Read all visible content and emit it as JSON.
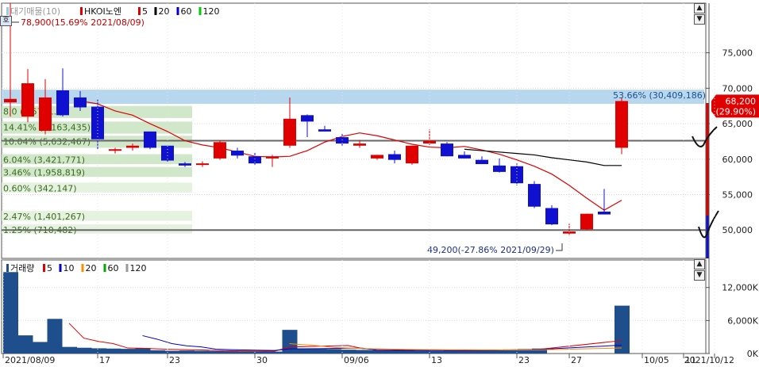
{
  "chart_data": [
    {
      "type": "candlestick",
      "legend": {
        "items": [
          {
            "label": "대기매물(10)",
            "color": "#9ecae1"
          },
          {
            "label": "HKOI노엔",
            "color": "#e00000"
          },
          {
            "label": "5",
            "color": "#e00000"
          },
          {
            "label": "20",
            "color": "#000000"
          },
          {
            "label": "60",
            "color": "#0000cc"
          },
          {
            "label": "120",
            "color": "#00cc00"
          }
        ]
      },
      "ylim": [
        46000,
        82000
      ],
      "yticks": [
        "75,000",
        "70,000",
        "65,000",
        "60,000",
        "55,000",
        "50,000"
      ],
      "ytick_values": [
        75000,
        70000,
        65000,
        60000,
        55000,
        50000
      ],
      "xticks": [
        "2021/08/09",
        "17",
        "23",
        "30",
        "09/06",
        "13",
        "23",
        "27",
        "10/05",
        "11",
        "2021/10/12"
      ],
      "xtick_index": [
        0,
        5,
        9,
        14,
        19,
        24,
        29,
        32,
        37,
        41,
        44
      ],
      "candles": [
        {
          "o": 68000,
          "h": 82000,
          "l": 66000,
          "c": 68500
        },
        {
          "o": 66000,
          "h": 72700,
          "l": 65200,
          "c": 70700
        },
        {
          "o": 64000,
          "h": 71300,
          "l": 63500,
          "c": 68700
        },
        {
          "o": 69700,
          "h": 72800,
          "l": 66000,
          "c": 66200
        },
        {
          "o": 68700,
          "h": 69600,
          "l": 66800,
          "c": 67300
        },
        {
          "o": 67400,
          "h": 68400,
          "l": 61400,
          "c": 62800
        },
        {
          "o": 61200,
          "h": 61600,
          "l": 60800,
          "c": 61400
        },
        {
          "o": 61600,
          "h": 62200,
          "l": 61200,
          "c": 61900
        },
        {
          "o": 63900,
          "h": 63900,
          "l": 61400,
          "c": 61600
        },
        {
          "o": 61900,
          "h": 61900,
          "l": 59600,
          "c": 59800
        },
        {
          "o": 59400,
          "h": 59600,
          "l": 58900,
          "c": 59100
        },
        {
          "o": 59200,
          "h": 59700,
          "l": 58900,
          "c": 59400
        },
        {
          "o": 60100,
          "h": 62600,
          "l": 59900,
          "c": 62400
        },
        {
          "o": 61200,
          "h": 61600,
          "l": 60100,
          "c": 60500
        },
        {
          "o": 60400,
          "h": 60900,
          "l": 59200,
          "c": 59400
        },
        {
          "o": 60100,
          "h": 60600,
          "l": 58900,
          "c": 60400
        },
        {
          "o": 61900,
          "h": 68700,
          "l": 61600,
          "c": 65700
        },
        {
          "o": 66200,
          "h": 66300,
          "l": 63100,
          "c": 65300
        },
        {
          "o": 64200,
          "h": 64700,
          "l": 63900,
          "c": 63900
        },
        {
          "o": 63100,
          "h": 63600,
          "l": 61900,
          "c": 62200
        },
        {
          "o": 61900,
          "h": 62700,
          "l": 61600,
          "c": 62200
        },
        {
          "o": 60100,
          "h": 60600,
          "l": 59900,
          "c": 60600
        },
        {
          "o": 60700,
          "h": 61200,
          "l": 59400,
          "c": 59900
        },
        {
          "o": 59400,
          "h": 61300,
          "l": 59200,
          "c": 61900
        },
        {
          "o": 62200,
          "h": 64200,
          "l": 62000,
          "c": 62600
        },
        {
          "o": 62200,
          "h": 62400,
          "l": 60400,
          "c": 60400
        },
        {
          "o": 60600,
          "h": 61100,
          "l": 60100,
          "c": 60100
        },
        {
          "o": 59900,
          "h": 60400,
          "l": 59300,
          "c": 59300
        },
        {
          "o": 59100,
          "h": 60100,
          "l": 58100,
          "c": 58200
        },
        {
          "o": 59000,
          "h": 59400,
          "l": 56300,
          "c": 56600
        },
        {
          "o": 56500,
          "h": 56900,
          "l": 53100,
          "c": 53300
        },
        {
          "o": 53100,
          "h": 53500,
          "l": 50700,
          "c": 50800
        },
        {
          "o": 49500,
          "h": 50900,
          "l": 49200,
          "c": 49800
        },
        {
          "o": 50100,
          "h": 52300,
          "l": 50000,
          "c": 52300
        },
        {
          "o": 52600,
          "h": 55800,
          "l": 52200,
          "c": 52200
        },
        {
          "o": 61600,
          "h": 68700,
          "l": 60700,
          "c": 68200
        }
      ],
      "ma": [
        {
          "name": "5",
          "color": "#e00000",
          "values": [
            null,
            null,
            null,
            null,
            68200,
            67800,
            66800,
            66200,
            65000,
            63900,
            62600,
            62000,
            61600,
            61000,
            60400,
            60300,
            60400,
            61200,
            62400,
            63200,
            63700,
            63300,
            62700,
            62100,
            61700,
            61600,
            61800,
            61300,
            60700,
            59900,
            59000,
            57900,
            56300,
            54500,
            52800,
            54200
          ]
        },
        {
          "name": "20",
          "color": "#000000",
          "values": [
            null,
            null,
            null,
            null,
            null,
            null,
            null,
            null,
            null,
            null,
            null,
            null,
            null,
            null,
            null,
            null,
            null,
            null,
            null,
            null,
            null,
            null,
            null,
            null,
            null,
            null,
            61400,
            61200,
            61000,
            60800,
            60600,
            60200,
            59900,
            59600,
            59100,
            59100
          ]
        },
        {
          "name": "60",
          "color": "#0000cc",
          "values": []
        },
        {
          "name": "120",
          "color": "#00cc00",
          "values": []
        }
      ],
      "overhang_bands": [
        {
          "top": 69800,
          "bottom": 67800,
          "label": "53.66% (30,409,186)",
          "label_side": "right",
          "color": "#b7d7ee"
        },
        {
          "top": 67500,
          "bottom": 65800,
          "label": "8.0 (4,570,...)",
          "label_side": "left",
          "color": "#c9e3bf"
        },
        {
          "top": 65300,
          "bottom": 63600,
          "label": "14.41% (8,163,435)",
          "label_side": "left",
          "color": "#c9e3bf"
        },
        {
          "top": 63300,
          "bottom": 61600,
          "label": "10.04% (5,632,467)",
          "label_side": "left",
          "color": "#c9e3bf"
        },
        {
          "top": 60700,
          "bottom": 59300,
          "label": "6.04% (3,421,771)",
          "label_side": "left",
          "color": "#c9e3bf"
        },
        {
          "top": 58900,
          "bottom": 57500,
          "label": "3.46% (1,958,819)",
          "label_side": "left",
          "color": "#c9e3bf"
        },
        {
          "top": 56700,
          "bottom": 55300,
          "label": "0.60% (342,147)",
          "label_side": "left",
          "color": "#e2f0db"
        },
        {
          "top": 52700,
          "bottom": 51300,
          "label": "2.47% (1,401,267)",
          "label_side": "left",
          "color": "#e2f0db"
        },
        {
          "top": 50800,
          "bottom": 49500,
          "label": "1.25% (710,482)",
          "label_side": "left",
          "color": "#e2f0db"
        }
      ],
      "hlines": [
        62600,
        50000
      ],
      "annotations": {
        "max": "78,900(15.69% 2021/08/09)",
        "min": "49,200(-27.86% 2021/09/29)",
        "last_price": "68,200",
        "last_change": "(29.90%)"
      }
    },
    {
      "type": "bar",
      "title": "거래량",
      "legend": {
        "items": [
          {
            "label": "거래량",
            "color": "#1f4e8c"
          },
          {
            "label": "5",
            "color": "#e00000"
          },
          {
            "label": "10",
            "color": "#0000cc"
          },
          {
            "label": "20",
            "color": "#ff8c00"
          },
          {
            "label": "60",
            "color": "#00aa00"
          },
          {
            "label": "120",
            "color": "#999999"
          }
        ]
      },
      "ylim": [
        0,
        17000
      ],
      "yticks": [
        "12,000K",
        "6,000K",
        "0K"
      ],
      "ytick_values": [
        12000,
        6000,
        0
      ],
      "values": [
        14800,
        3300,
        2100,
        6300,
        1200,
        1050,
        950,
        900,
        850,
        1000,
        600,
        500,
        550,
        500,
        450,
        420,
        400,
        380,
        350,
        4300,
        900,
        850,
        800,
        700,
        650,
        600,
        550,
        500,
        480,
        450,
        500,
        550,
        650,
        700,
        750,
        800,
        900,
        8700
      ],
      "ma": [
        {
          "name": "5",
          "color": "#e00000",
          "values": [
            null,
            null,
            null,
            null,
            5500,
            2800,
            2200,
            1800,
            1000,
            950,
            850,
            750,
            700,
            650,
            550,
            500,
            470,
            450,
            430,
            1170,
            1240,
            1330,
            1390,
            1450,
            880,
            770,
            730,
            660,
            610,
            570,
            540,
            530,
            550,
            600,
            650,
            690,
            760,
            2350
          ]
        },
        {
          "name": "10",
          "color": "#0000cc",
          "values": [
            null,
            null,
            null,
            null,
            null,
            null,
            null,
            null,
            null,
            3250,
            2600,
            1800,
            1400,
            1200,
            800,
            700,
            650,
            600,
            550,
            840,
            860,
            890,
            920,
            950,
            970,
            580,
            570,
            560,
            550,
            540,
            560,
            570,
            600,
            620,
            650,
            680,
            730,
            1530
          ]
        },
        {
          "name": "20",
          "color": "#ff8c00",
          "values": [
            null,
            null,
            null,
            null,
            null,
            null,
            null,
            null,
            null,
            null,
            null,
            null,
            null,
            null,
            null,
            null,
            null,
            null,
            null,
            1800,
            1600,
            1400,
            1100,
            1000,
            900,
            850,
            800,
            760,
            720,
            700,
            690,
            680,
            670,
            660,
            650,
            640,
            660,
            1000
          ]
        }
      ]
    }
  ]
}
